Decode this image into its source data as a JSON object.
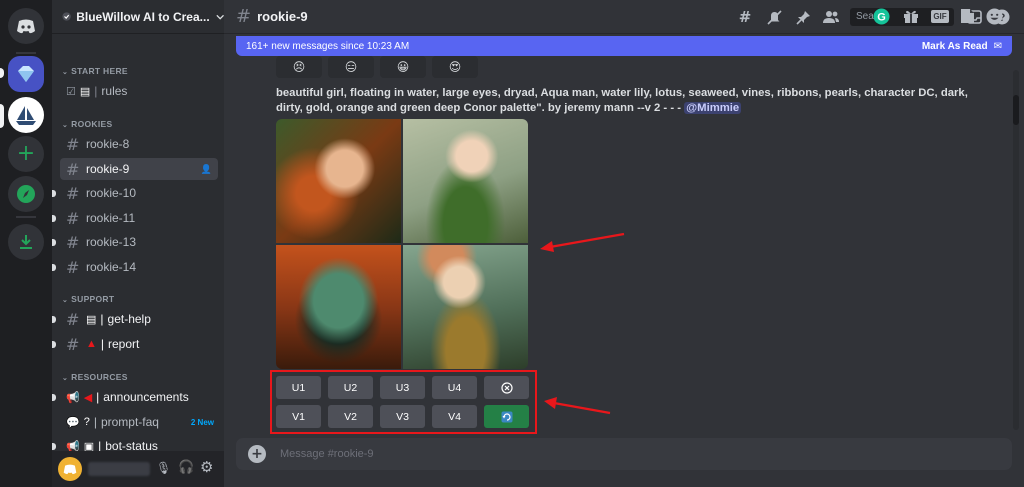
{
  "guild": {
    "name": "BlueWillow AI to Crea..."
  },
  "categories": {
    "start_here": "START HERE",
    "rookies": "ROOKIES",
    "support": "SUPPORT",
    "resources": "RESOURCES"
  },
  "channels": {
    "rules": "rules",
    "rookie8": "rookie-8",
    "rookie9": "rookie-9",
    "rookie10": "rookie-10",
    "rookie11": "rookie-11",
    "rookie13": "rookie-13",
    "rookie14": "rookie-14",
    "get_help": "get-help",
    "report": "report",
    "announcements": "announcements",
    "prompt_faq": "prompt-faq",
    "prompt_faq_badge": "2 New",
    "bot_status": "bot-status"
  },
  "topbar": {
    "channel_title": "rookie-9",
    "search_placeholder": "Search"
  },
  "banner": {
    "text": "161+ new messages since 10:23 AM",
    "action": "Mark As Read"
  },
  "reactions": [
    "😣",
    "😑",
    "😀",
    "😍"
  ],
  "message": {
    "text": "beautiful girl, floating in water, large eyes, dryad, Aqua man, water lily, lotus, seaweed, vines, ribbons, pearls, character DC, dark, dirty, gold, orange and green deep Conor palette\". by jeremy mann --v 2 - - -",
    "mention": "@Mimmie"
  },
  "buttons": {
    "u1": "U1",
    "u2": "U2",
    "u3": "U3",
    "u4": "U4",
    "v1": "V1",
    "v2": "V2",
    "v3": "V3",
    "v4": "V4"
  },
  "composer": {
    "placeholder": "Message #rookie-9"
  },
  "colors": {
    "blurple": "#5865f2",
    "green": "#248046",
    "red_annotation": "#e8171b"
  },
  "icons": [
    "discord-icon",
    "threads-icon",
    "mute-icon",
    "pin-icon",
    "members-icon",
    "search-icon",
    "inbox-icon",
    "help-icon",
    "mic-muted-icon",
    "headphones-icon",
    "settings-icon",
    "gift-icon",
    "gif-icon",
    "sticker-icon",
    "emoji-icon",
    "refresh-icon"
  ]
}
